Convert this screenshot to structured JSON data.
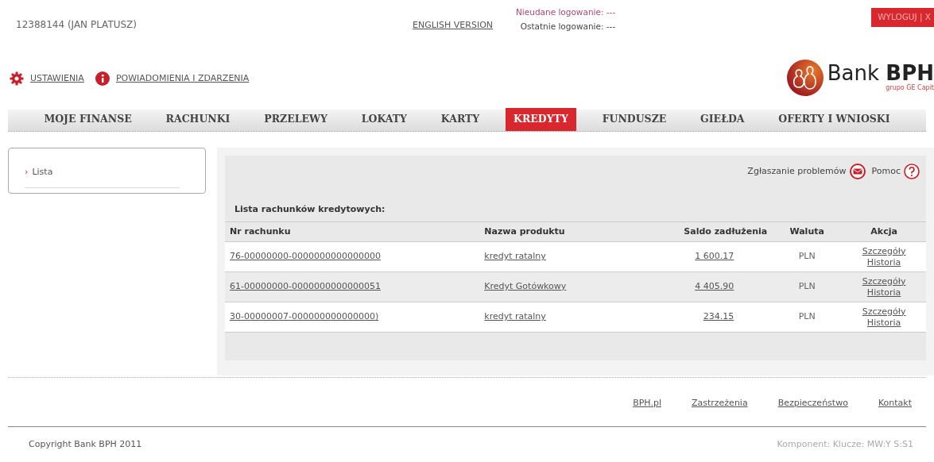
{
  "header": {
    "user": "12388144  (JAN PLATUSZ)",
    "language_link": "ENGLISH VERSION",
    "failed_login": "Nieudane logowanie: ---",
    "last_login": "Ostatnie logowanie: ---",
    "logout": "WYLOGUJ | X"
  },
  "top_links": [
    {
      "kind": "settings",
      "label": "USTAWIENIA"
    },
    {
      "kind": "info",
      "label": "POWIADOMIENIA I ZDARZENIA"
    }
  ],
  "logo": {
    "word": "Bank",
    "brand": "BPH",
    "tagline": "grupo GE Capit"
  },
  "nav": [
    {
      "label": "MOJE FINANSE",
      "selected": false
    },
    {
      "label": "RACHUNKI",
      "selected": false
    },
    {
      "label": "PRZELEWY",
      "selected": false
    },
    {
      "label": "LOKATY",
      "selected": false
    },
    {
      "label": "KARTY",
      "selected": false
    },
    {
      "label": "KREDYTY",
      "selected": true
    },
    {
      "label": "FUNDUSZE",
      "selected": false
    },
    {
      "label": "GIEŁDA",
      "selected": false
    },
    {
      "label": "OFERTY I WNIOSKI",
      "selected": false
    }
  ],
  "sidebar": {
    "items": [
      {
        "marker": "›",
        "label": "Lista"
      }
    ]
  },
  "tools": [
    {
      "kind": "mail",
      "label": "Zgłaszanie problemów"
    },
    {
      "kind": "help",
      "label": "Pomoc"
    }
  ],
  "table": {
    "title": "Lista rachunków kredytowych:",
    "columns": [
      "Nr rachunku",
      "Nazwa produktu",
      "Saldo zadłużenia",
      "Waluta",
      "Akcja"
    ],
    "rows": [
      {
        "account": "76-00000000-0000000000000000",
        "product": "kredyt ratalny",
        "balance": "1 600.17",
        "currency": "PLN",
        "actions": [
          "Szczegóły",
          "Historia"
        ]
      },
      {
        "account": "61-00000000-0000000000000051",
        "product": "Kredyt Gotówkowy",
        "balance": "4 405.90",
        "currency": "PLN",
        "actions": [
          "Szczegóły",
          "Historia"
        ]
      },
      {
        "account": "30-00000007-000000000000000)",
        "product": "kredyt ratalny",
        "balance": "234.15",
        "currency": "PLN",
        "actions": [
          "Szczegóły",
          "Historia"
        ]
      }
    ]
  },
  "footer": {
    "links": [
      "BPH.pl",
      "Zastrzeżenia",
      "Bezpieczeństwo",
      "Kontakt"
    ],
    "copyright": "Copyright Bank BPH 2011",
    "component_info": "Komponent:  Klucze:  MW:Y S:S1"
  }
}
